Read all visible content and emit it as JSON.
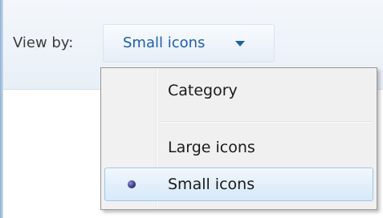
{
  "toolbar": {
    "view_by_label": "View by:",
    "view_by_value": "Small icons"
  },
  "menu": {
    "items": [
      {
        "label": "Category",
        "selected": false
      },
      {
        "label": "Large icons",
        "selected": false
      },
      {
        "label": "Small icons",
        "selected": true
      }
    ]
  },
  "icons": {
    "dropdown": "caret-down-icon",
    "selection": "radio-bullet-icon"
  },
  "colors": {
    "link_blue": "#1e5fa8",
    "highlight_border": "#9ec7ec",
    "menu_background": "#f0f0f0"
  }
}
